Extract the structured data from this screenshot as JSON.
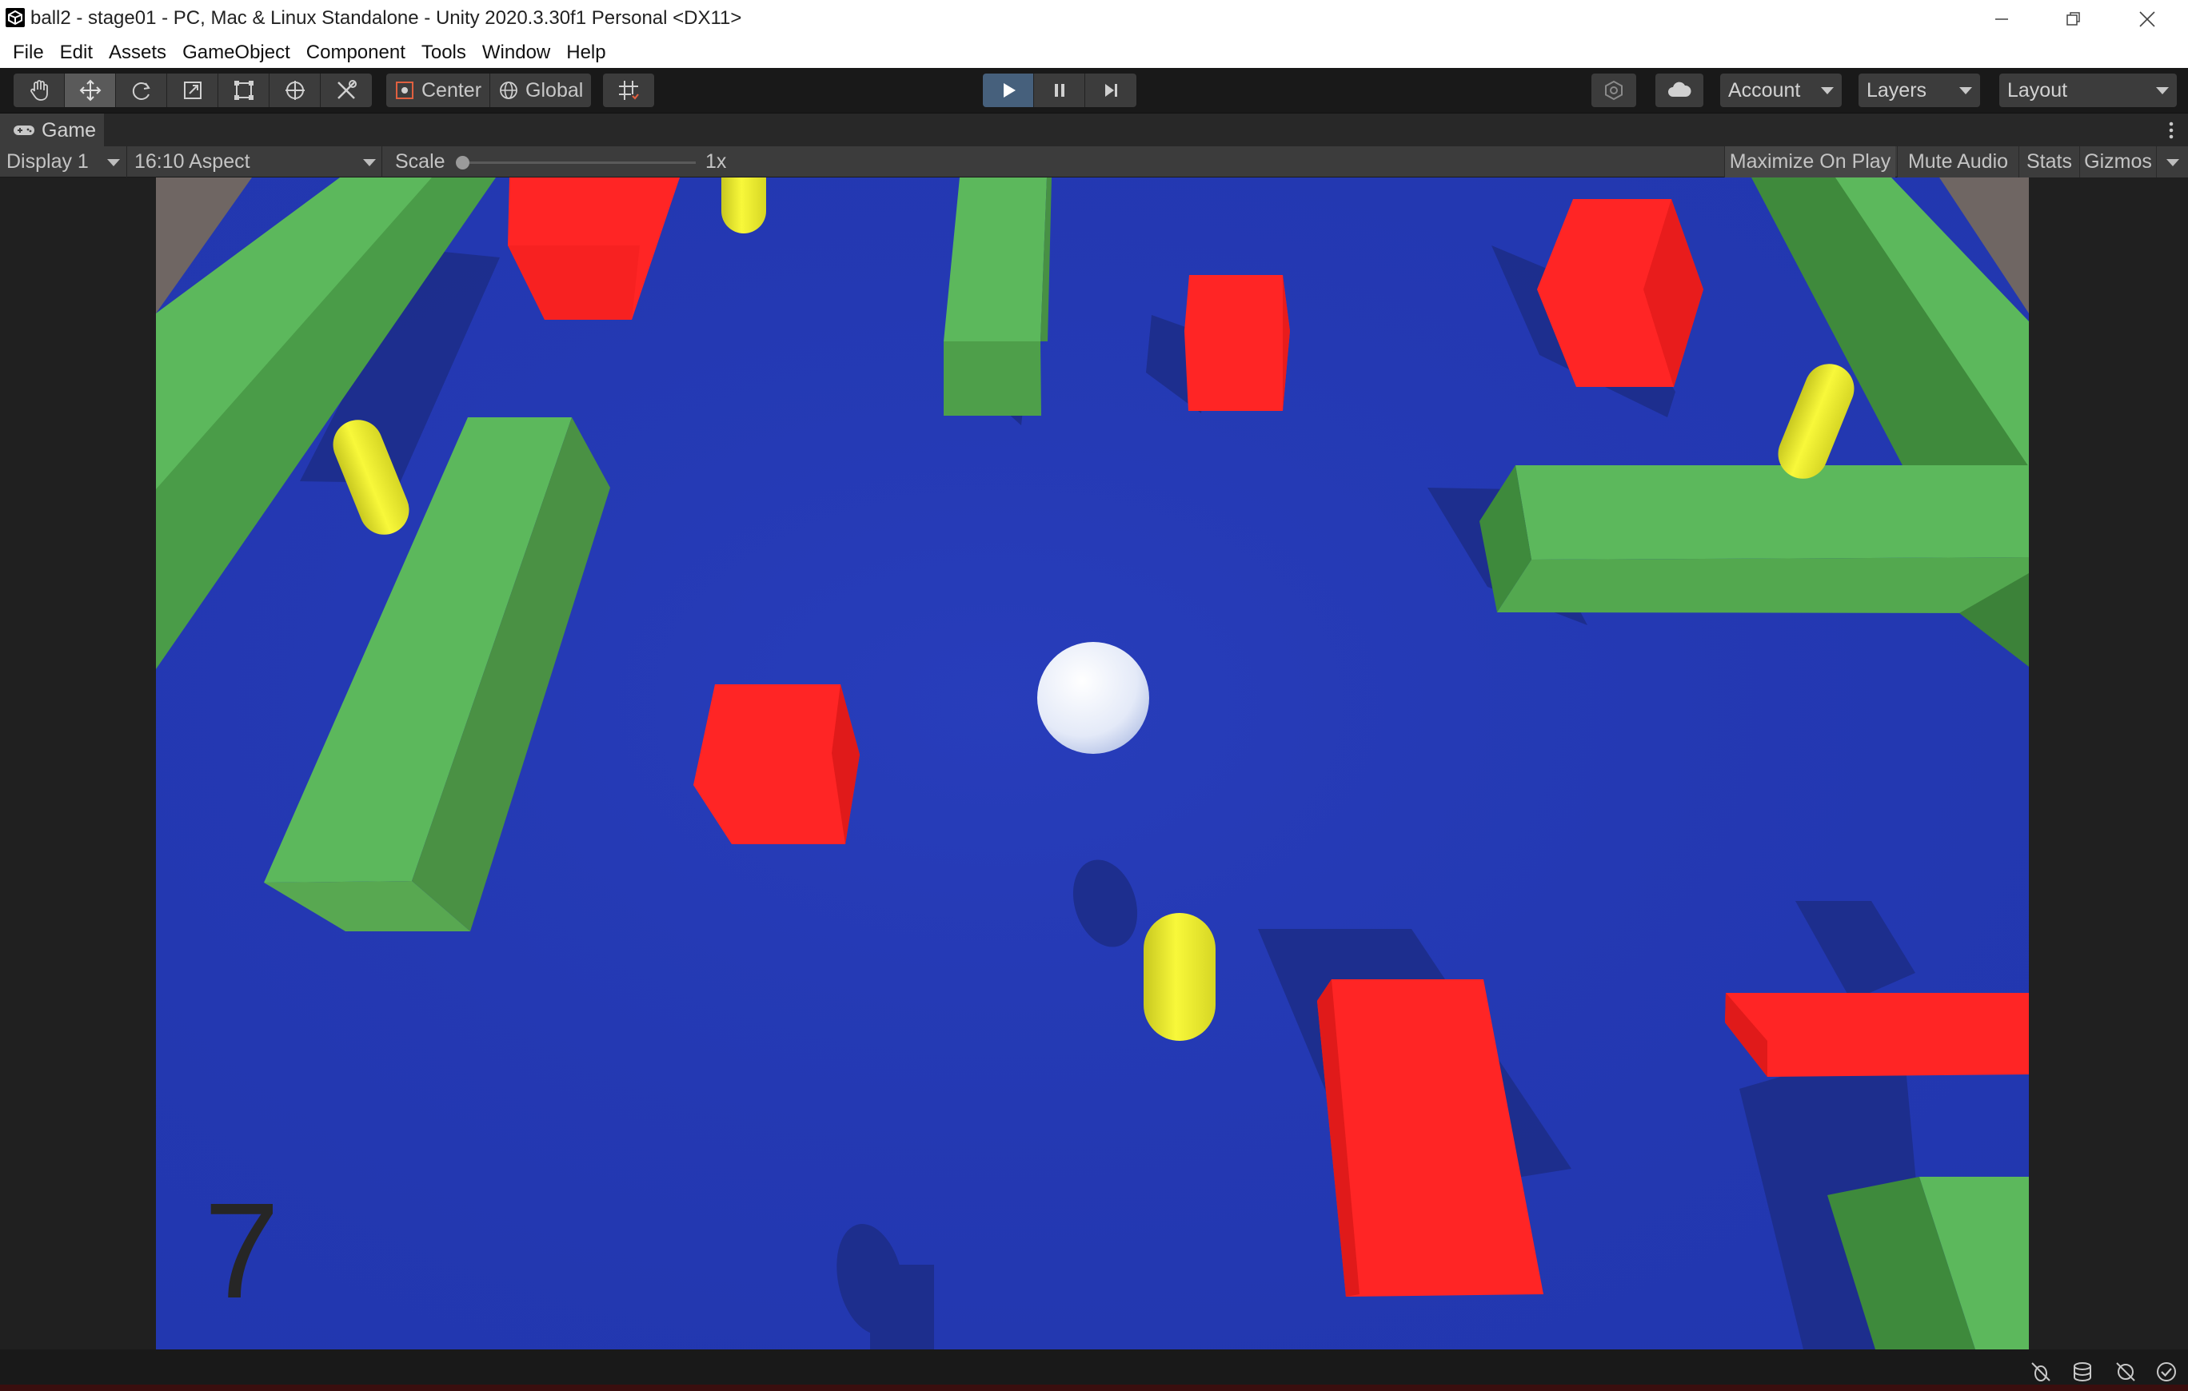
{
  "window": {
    "title": "ball2 - stage01 - PC, Mac & Linux Standalone - Unity 2020.3.30f1 Personal <DX11>",
    "controls": [
      "minimize",
      "restore",
      "close"
    ]
  },
  "menu": {
    "items": [
      "File",
      "Edit",
      "Assets",
      "GameObject",
      "Component",
      "Tools",
      "Window",
      "Help"
    ]
  },
  "toolbar": {
    "tools": [
      "hand-tool",
      "move-tool",
      "rotate-tool",
      "scale-tool",
      "rect-tool",
      "transform-tool",
      "custom-tool"
    ],
    "active_tool": "move-tool",
    "pivot_label": "Center",
    "space_label": "Global",
    "play_state": "playing",
    "account_label": "Account",
    "layers_label": "Layers",
    "layout_label": "Layout"
  },
  "game_view": {
    "tab_label": "Game",
    "display_label": "Display 1",
    "aspect_label": "16:10 Aspect",
    "scale_label": "Scale",
    "scale_value": "1x",
    "maximize_label": "Maximize On Play",
    "mute_label": "Mute Audio",
    "stats_label": "Stats",
    "gizmos_label": "Gizmos",
    "counter": "7"
  },
  "colors": {
    "floor": "#2439b3",
    "wall_light": "#5cb85c",
    "wall_dark": "#3f8f3f",
    "cube_red": "#ff2020",
    "capsule_yellow": "#f0f028",
    "ball_white": "#f0f4ff",
    "play_active": "#46607c"
  }
}
